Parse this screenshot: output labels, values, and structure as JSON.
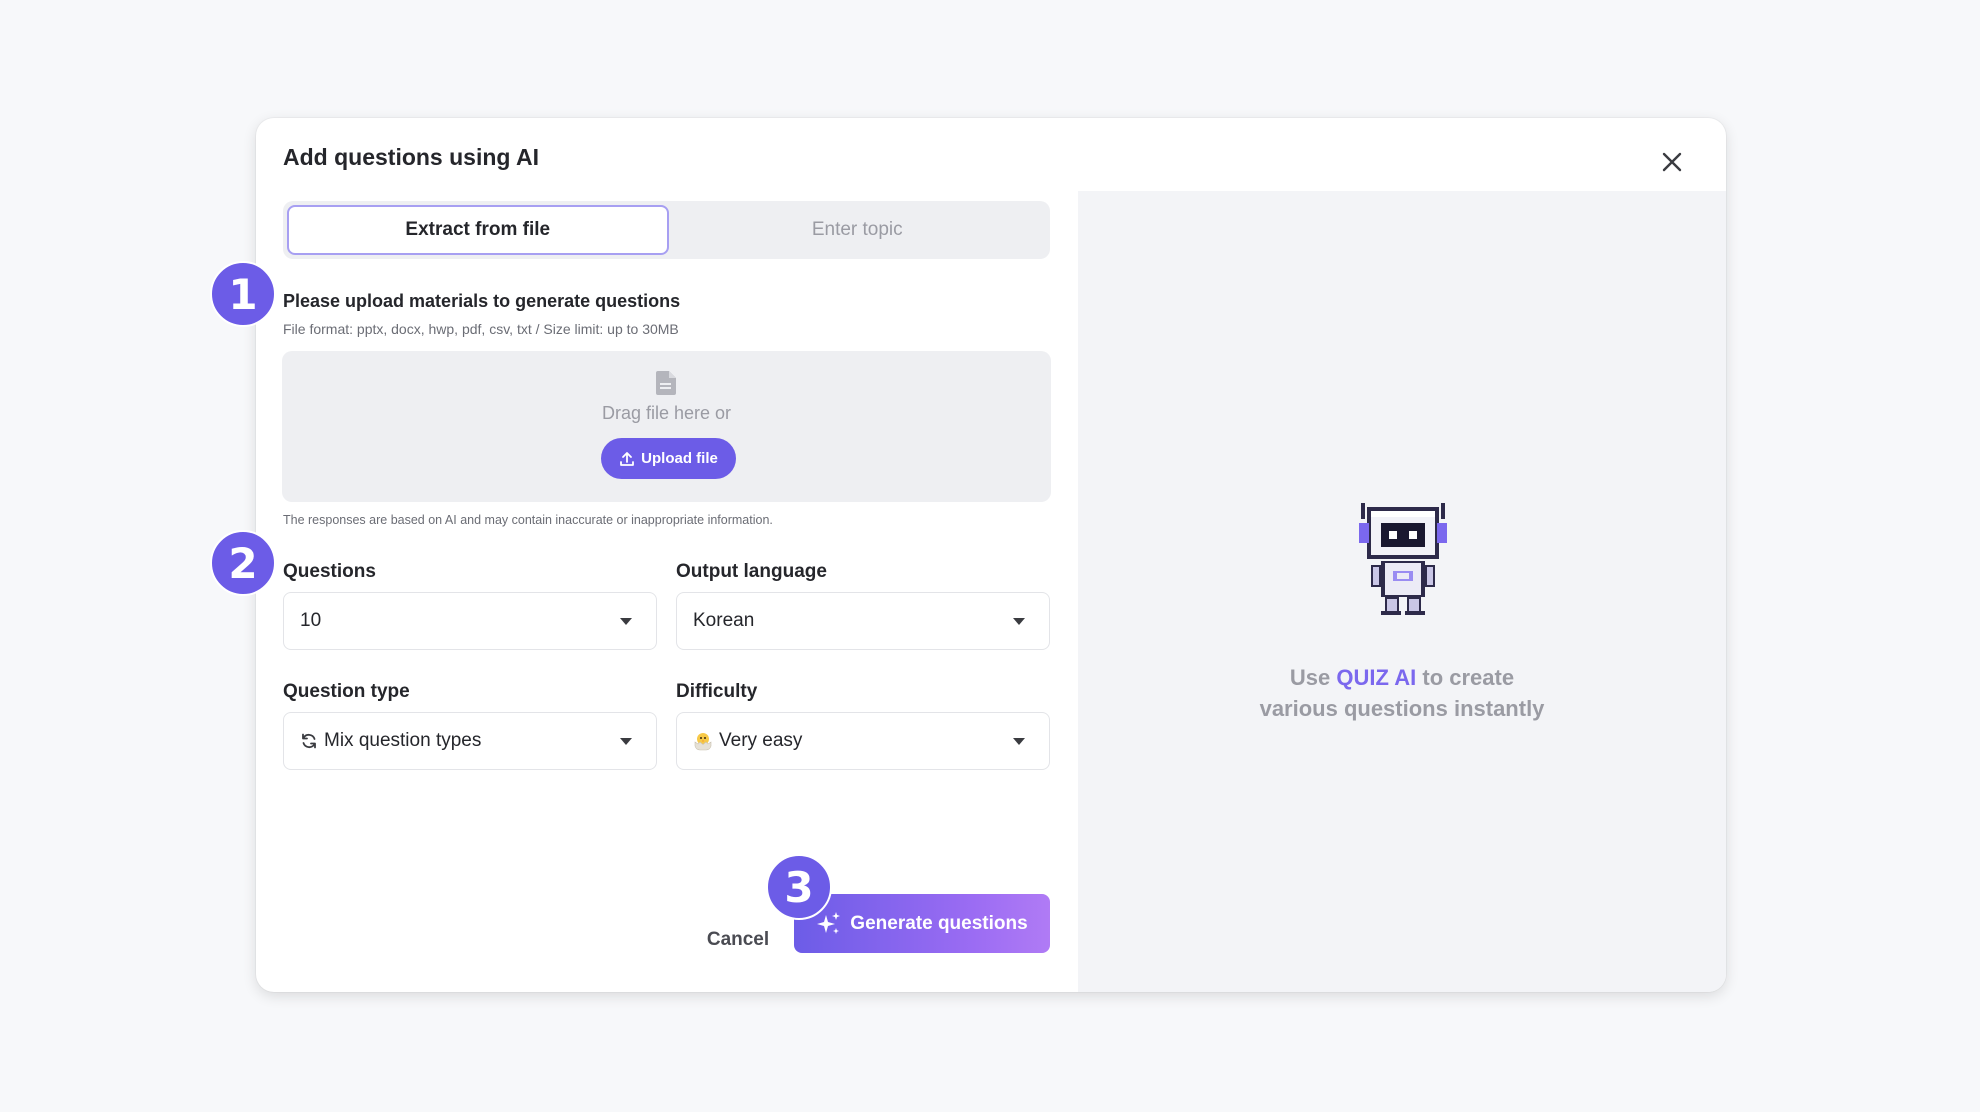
{
  "modal": {
    "title": "Add questions using AI",
    "close_icon": "close-icon"
  },
  "tabs": [
    {
      "label": "Extract from file",
      "active": true
    },
    {
      "label": "Enter topic",
      "active": false
    }
  ],
  "upload": {
    "title": "Please upload materials to generate questions",
    "subtitle": "File format: pptx, docx, hwp, pdf, csv, txt / Size limit: up to 30MB",
    "drag_text": "Drag file here or",
    "upload_button": "Upload file",
    "disclaimer": "The responses are based on AI and may contain inaccurate or inappropriate information."
  },
  "fields": {
    "questions": {
      "label": "Questions",
      "value": "10"
    },
    "output_language": {
      "label": "Output language",
      "value": "Korean"
    },
    "question_type": {
      "label": "Question type",
      "value": "Mix question types",
      "icon": "refresh-icon"
    },
    "difficulty": {
      "label": "Difficulty",
      "value": "Very easy",
      "icon": "hatching-chick-emoji"
    }
  },
  "actions": {
    "cancel": "Cancel",
    "generate": "Generate questions"
  },
  "promo": {
    "prefix": "Use ",
    "brand": "QUIZ AI",
    "suffix": " to create",
    "line2": "various questions instantly"
  },
  "steps": [
    "1",
    "2",
    "3"
  ],
  "colors": {
    "accent": "#6c5ce7",
    "accent_gradient_end": "#b07bf5",
    "background": "#f7f8fa",
    "panel": "#f3f4f7"
  }
}
